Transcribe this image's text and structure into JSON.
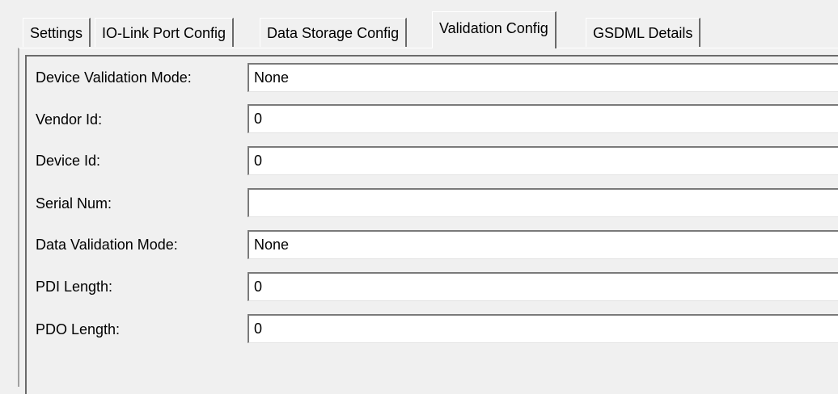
{
  "tabs": [
    {
      "label": "Settings",
      "active": false
    },
    {
      "label": "IO-Link Port Config",
      "active": false
    },
    {
      "label": "Data Storage Config",
      "active": false
    },
    {
      "label": "Validation Config",
      "active": true
    },
    {
      "label": "GSDML Details",
      "active": false
    }
  ],
  "form": {
    "device_validation_mode": {
      "label": "Device Validation Mode:",
      "value": "None"
    },
    "vendor_id": {
      "label": "Vendor Id:",
      "value": "0"
    },
    "device_id": {
      "label": "Device Id:",
      "value": "0"
    },
    "serial_num": {
      "label": "Serial Num:",
      "value": ""
    },
    "data_validation_mode": {
      "label": "Data Validation Mode:",
      "value": "None"
    },
    "pdi_length": {
      "label": "PDI Length:",
      "value": "0"
    },
    "pdo_length": {
      "label": "PDO Length:",
      "value": "0"
    }
  }
}
